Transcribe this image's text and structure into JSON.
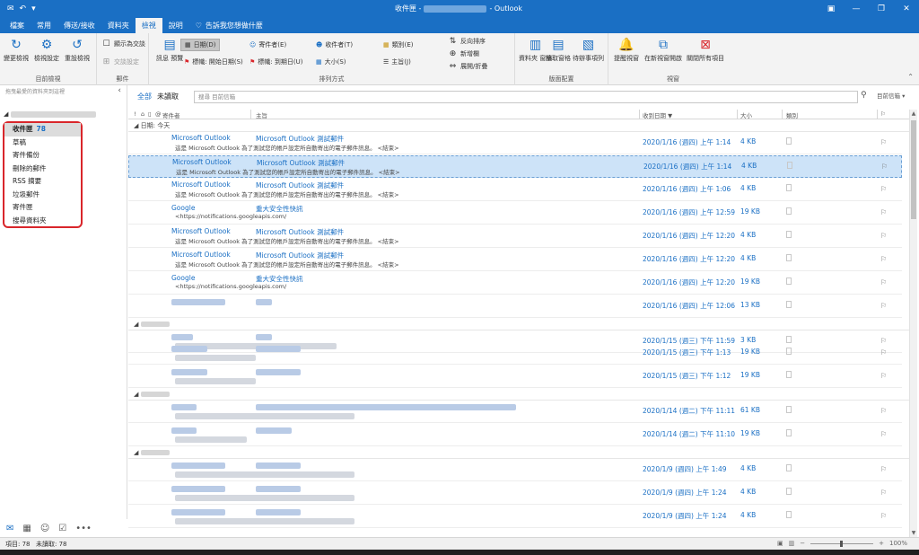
{
  "titlebar": {
    "title_prefix": "收件匣 -",
    "title_suffix": "- Outlook",
    "qat_icons": [
      "envelope-icon",
      "undo-icon",
      "customize-icon"
    ]
  },
  "tabs": [
    "檔案",
    "常用",
    "傳送/接收",
    "資料夾",
    "檢視",
    "說明",
    "告訴我您想做什麼"
  ],
  "active_tab": "檢視",
  "ribbon": {
    "groups": {
      "current_view": "目前檢視",
      "messages": "郵件",
      "arrangement": "排列方式",
      "layout": "版面配置",
      "window": "視窗"
    },
    "change_view": "變更檢視",
    "view_settings": "檢視設定",
    "reset_view": "重設檢視",
    "show_as_conversations": "顯示為交談",
    "conversation_settings": "交談設定",
    "message_preview": "訊息\n預覽",
    "arrange": {
      "date": "日期(D)",
      "from": "寄件者(E)",
      "to": "收件者(T)",
      "categories": "類別(E)",
      "flag_start": "標幟: 開始日期(S)",
      "flag_due": "標幟: 到期日(U)",
      "size": "大小(S)",
      "subject": "主旨(J)",
      "reverse_sort": "反向排序",
      "add_columns": "新增欄",
      "expand_collapse": "展開/折疊"
    },
    "layout": {
      "folder_pane": "資料夾\n窗格",
      "reading_pane": "讀取窗格",
      "todo_bar": "待辦事項列"
    },
    "window": {
      "reminders": "提醒視窗",
      "open_new_window": "在新視窗開啟",
      "close_all_items": "關閉所有項目"
    }
  },
  "folder_pane": {
    "hint": "拖曳最愛的資料夾到這裡",
    "folders": [
      {
        "name": "收件匣",
        "count": "78",
        "selected": true
      },
      {
        "name": "草稿",
        "count": ""
      },
      {
        "name": "寄件備份",
        "count": ""
      },
      {
        "name": "刪除的郵件",
        "count": ""
      },
      {
        "name": "RSS 摘要",
        "count": ""
      },
      {
        "name": "垃圾郵件",
        "count": ""
      },
      {
        "name": "寄件匣",
        "count": ""
      },
      {
        "name": "搜尋資料夾",
        "count": ""
      }
    ]
  },
  "filters": {
    "all": "全部",
    "unread": "未讀取"
  },
  "search": {
    "placeholder": "搜尋 目前信箱",
    "scope": "目前信箱"
  },
  "columns": {
    "from": "寄件者",
    "subject": "主旨",
    "received": "收到日期 ▼",
    "size": "大小",
    "categories": "類別"
  },
  "group_today": "日期: 今天",
  "messages": [
    {
      "sender": "Microsoft Outlook",
      "subject": "Microsoft Outlook 測試郵件",
      "preview": "這是 Microsoft Outlook 為了測試您的帳戶設定所自動寄出的電子郵件訊息。  <結束>",
      "date": "2020/1/16 (週四) 上午 1:14",
      "size": "4 KB"
    },
    {
      "sender": "Microsoft Outlook",
      "subject": "Microsoft Outlook 測試郵件",
      "preview": "這是 Microsoft Outlook 為了測試您的帳戶設定所自動寄出的電子郵件訊息。  <結束>",
      "date": "2020/1/16 (週四) 上午 1:14",
      "size": "4 KB",
      "selected": true
    },
    {
      "sender": "Microsoft Outlook",
      "subject": "Microsoft Outlook 測試郵件",
      "preview": "這是 Microsoft Outlook 為了測試您的帳戶設定所自動寄出的電子郵件訊息。  <結束>",
      "date": "2020/1/16 (週四) 上午 1:06",
      "size": "4 KB"
    },
    {
      "sender": "Google",
      "subject": "重大安全性快訊",
      "preview": "<https://notifications.googleapis.com/",
      "date": "2020/1/16 (週四) 上午 12:59",
      "size": "19 KB"
    },
    {
      "sender": "Microsoft Outlook",
      "subject": "Microsoft Outlook 測試郵件",
      "preview": "這是 Microsoft Outlook 為了測試您的帳戶設定所自動寄出的電子郵件訊息。  <結束>",
      "date": "2020/1/16 (週四) 上午 12:20",
      "size": "4 KB"
    },
    {
      "sender": "Microsoft Outlook",
      "subject": "Microsoft Outlook 測試郵件",
      "preview": "這是 Microsoft Outlook 為了測試您的帳戶設定所自動寄出的電子郵件訊息。  <結束>",
      "date": "2020/1/16 (週四) 上午 12:20",
      "size": "4 KB"
    },
    {
      "sender": "Google",
      "subject": "重大安全性快訊",
      "preview": "<https://notifications.googleapis.com/",
      "date": "2020/1/16 (週四) 上午 12:20",
      "size": "19 KB"
    },
    {
      "sender": "",
      "subject": "",
      "preview": "",
      "date": "2020/1/16 (週四) 上午 12:06",
      "size": "13 KB",
      "blurred": true
    }
  ],
  "older_messages": [
    {
      "date": "2020/1/15 (週三) 下午 11:59",
      "size": "3 KB"
    },
    {
      "date": "2020/1/15 (週三) 下午 1:13",
      "size": "19 KB"
    },
    {
      "date": "2020/1/15 (週三) 下午 1:12",
      "size": "19 KB"
    },
    {
      "date": "2020/1/14 (週二) 下午 11:11",
      "size": "61 KB"
    },
    {
      "date": "2020/1/14 (週二) 下午 11:10",
      "size": "19 KB"
    },
    {
      "date": "2020/1/9 (週四) 上午 1:49",
      "size": "4 KB"
    },
    {
      "date": "2020/1/9 (週四) 上午 1:24",
      "size": "4 KB"
    },
    {
      "date": "2020/1/9 (週四) 上午 1:24",
      "size": "4 KB"
    }
  ],
  "statusbar": {
    "items": "項目: 78",
    "unread": "未讀取: 78",
    "zoom": "100%"
  },
  "colors": {
    "accent": "#1a6fc4",
    "highlight": "#d9262b",
    "selected_row": "#cde3f8"
  }
}
